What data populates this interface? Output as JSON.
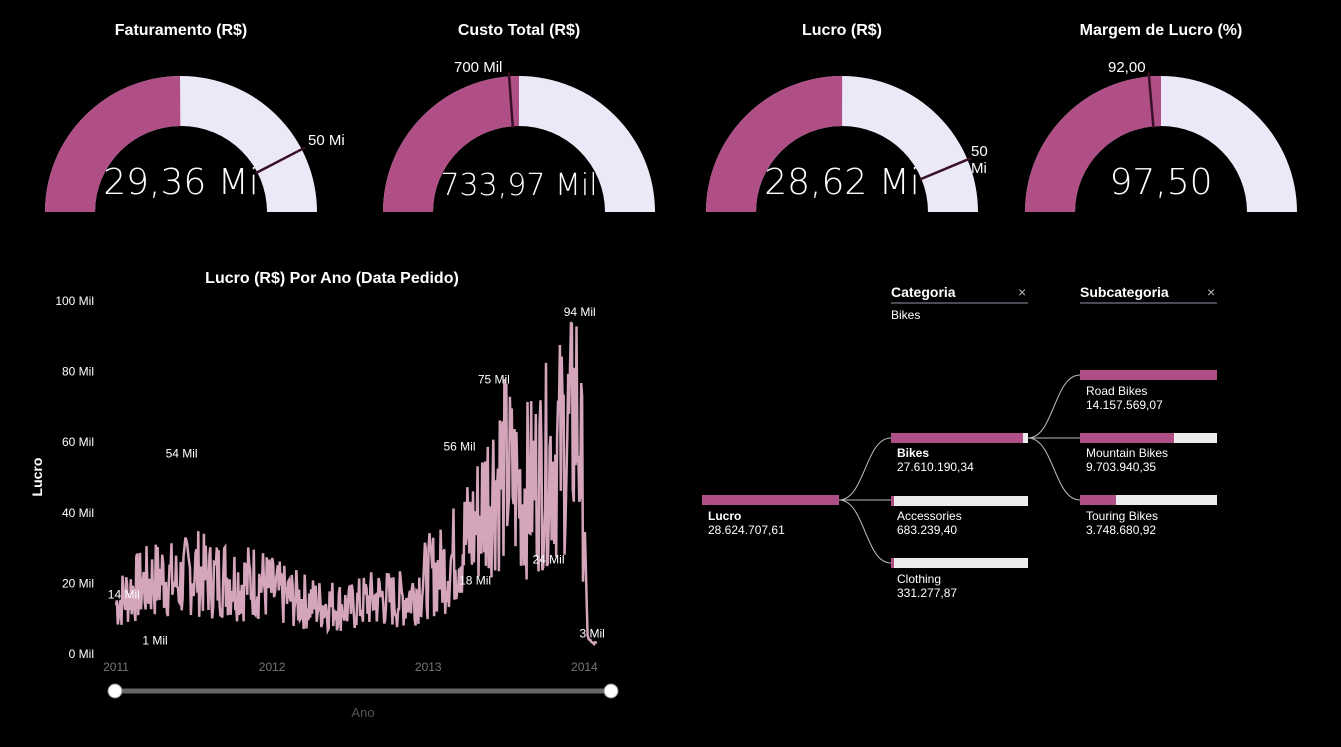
{
  "colors": {
    "accent": "#b04f85",
    "track": "#ebe9f7",
    "line": "#d4a5bb",
    "target": "#3a0f28"
  },
  "gauges": [
    {
      "title": "Faturamento (R$)",
      "value_text": "29,36 Mi",
      "target_text": "50 Mi",
      "value": 29.36,
      "min": 0,
      "max": 59,
      "target": 50
    },
    {
      "title": "Custo Total (R$)",
      "value_text": "733,97 Mil",
      "target_text": "700 Mil",
      "value": 733.97,
      "min": 0,
      "max": 1468,
      "target": 700
    },
    {
      "title": "Lucro (R$)",
      "value_text": "28,62 Mi",
      "target_text": "50 Mi",
      "value": 28.62,
      "min": 0,
      "max": 57.2,
      "target": 50
    },
    {
      "title": "Margem de Lucro (%)",
      "value_text": "97,50",
      "target_text": "92,00",
      "value": 97.5,
      "min": 0,
      "max": 195,
      "target": 92
    }
  ],
  "chart_data": {
    "type": "line",
    "title": "Lucro (R$) Por Ano (Data Pedido)",
    "xlabel": "Ano",
    "ylabel": "Lucro",
    "x_ticks": [
      "2011",
      "2012",
      "2013",
      "2014"
    ],
    "y_ticks": [
      "0 Mil",
      "20 Mil",
      "40 Mil",
      "60 Mil",
      "80 Mil",
      "100 Mil"
    ],
    "ylim": [
      0,
      100
    ],
    "xlim": [
      2011.0,
      2014.1
    ],
    "series": [
      {
        "x": [
          2011.0,
          2011.1,
          2011.2,
          2011.3,
          2011.4,
          2011.5,
          2011.6,
          2011.7,
          2011.8,
          2011.9,
          2012.0,
          2012.1,
          2012.2,
          2012.3,
          2012.4,
          2012.5,
          2012.6,
          2012.7,
          2012.8,
          2012.9,
          2013.0,
          2013.1,
          2013.2,
          2013.3,
          2013.4,
          2013.5,
          2013.6,
          2013.7,
          2013.8,
          2013.9,
          2013.95,
          2014.0,
          2014.02,
          2014.05,
          2014.08
        ],
        "y": [
          14,
          18,
          20,
          22,
          20,
          24,
          21,
          22,
          20,
          21,
          18,
          16,
          15,
          14,
          14,
          13,
          15,
          16,
          15,
          17,
          22,
          24,
          30,
          36,
          48,
          52,
          45,
          50,
          56,
          62,
          70,
          40,
          5,
          3,
          3
        ]
      }
    ],
    "annotations": [
      {
        "x": 2011.05,
        "y": 14,
        "label": "14 Mil"
      },
      {
        "x": 2011.25,
        "y": 1,
        "label": "1 Mil"
      },
      {
        "x": 2011.42,
        "y": 54,
        "label": "54 Mil"
      },
      {
        "x": 2013.2,
        "y": 56,
        "label": "56 Mil"
      },
      {
        "x": 2013.42,
        "y": 75,
        "label": "75 Mil"
      },
      {
        "x": 2013.3,
        "y": 18,
        "label": "18 Mil"
      },
      {
        "x": 2013.77,
        "y": 24,
        "label": "24 Mil"
      },
      {
        "x": 2013.97,
        "y": 94,
        "label": "94 Mil"
      },
      {
        "x": 2014.05,
        "y": 3,
        "label": "3 Mil"
      }
    ]
  },
  "tree": {
    "headers": [
      {
        "title": "Categoria",
        "selected": "Bikes"
      },
      {
        "title": "Subcategoria",
        "selected": ""
      }
    ],
    "close_glyph": "×",
    "root": {
      "name": "Lucro",
      "value_text": "28.624.707,61",
      "value": 28624707.61
    },
    "categories": [
      {
        "name": "Bikes",
        "value_text": "27.610.190,34",
        "value": 27610190.34,
        "selected": true
      },
      {
        "name": "Accessories",
        "value_text": "683.239,40",
        "value": 683239.4
      },
      {
        "name": "Clothing",
        "value_text": "331.277,87",
        "value": 331277.87
      }
    ],
    "subcategories": [
      {
        "name": "Road Bikes",
        "value_text": "14.157.569,07",
        "value": 14157569.07
      },
      {
        "name": "Mountain Bikes",
        "value_text": "9.703.940,35",
        "value": 9703940.35
      },
      {
        "name": "Touring Bikes",
        "value_text": "3.748.680,92",
        "value": 3748680.92
      }
    ]
  }
}
